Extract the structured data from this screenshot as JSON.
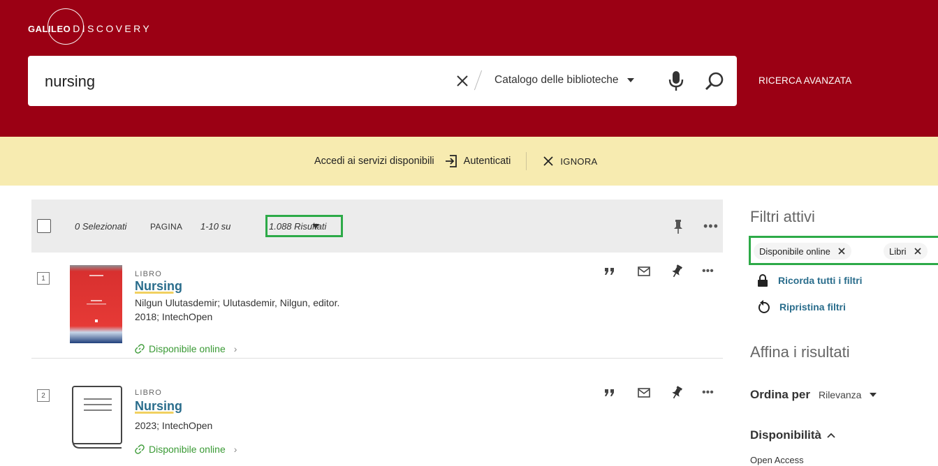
{
  "header": {
    "logo_bold": "GALILEO",
    "logo_light": "DISCOVERY",
    "search_value": "nursing",
    "scope_label": "Catalogo delle biblioteche",
    "advanced_search_label": "RICERCA AVANZATA"
  },
  "signin_bar": {
    "message": "Accedi ai servizi disponibili",
    "login_label": "Autenticati",
    "dismiss_label": "IGNORA"
  },
  "toolbar": {
    "selected_count": "0 Selezionati",
    "page_label": "PAGINA",
    "range_text": "1-10 su",
    "total_results": "1.088 Risultati"
  },
  "results": [
    {
      "index": "1",
      "type": "LIBRO",
      "title": "Nursing",
      "authors": "Nilgun Ulutasdemir; Ulutasdemir, Nilgun, editor.",
      "publication": "2018; IntechOpen",
      "availability": "Disponibile online"
    },
    {
      "index": "2",
      "type": "LIBRO",
      "title": "Nursing",
      "authors": "",
      "publication": "2023; IntechOpen",
      "availability": "Disponibile online"
    }
  ],
  "sidebar": {
    "active_filters_heading": "Filtri attivi",
    "filter_chips": [
      "Disponibile online",
      "Libri"
    ],
    "remember_filters": "Ricorda tutti i filtri",
    "reset_filters": "Ripristina filtri",
    "refine_heading": "Affina i risultati",
    "sort_label": "Ordina per",
    "sort_value": "Rilevanza",
    "availability_heading": "Disponibilità",
    "open_access": "Open Access"
  },
  "colors": {
    "header_bg": "#9b0014",
    "signin_bg": "#f7ebb0",
    "link_blue": "#2a6d8c",
    "online_green": "#3a9a35",
    "highlight_green": "#2daa48"
  }
}
